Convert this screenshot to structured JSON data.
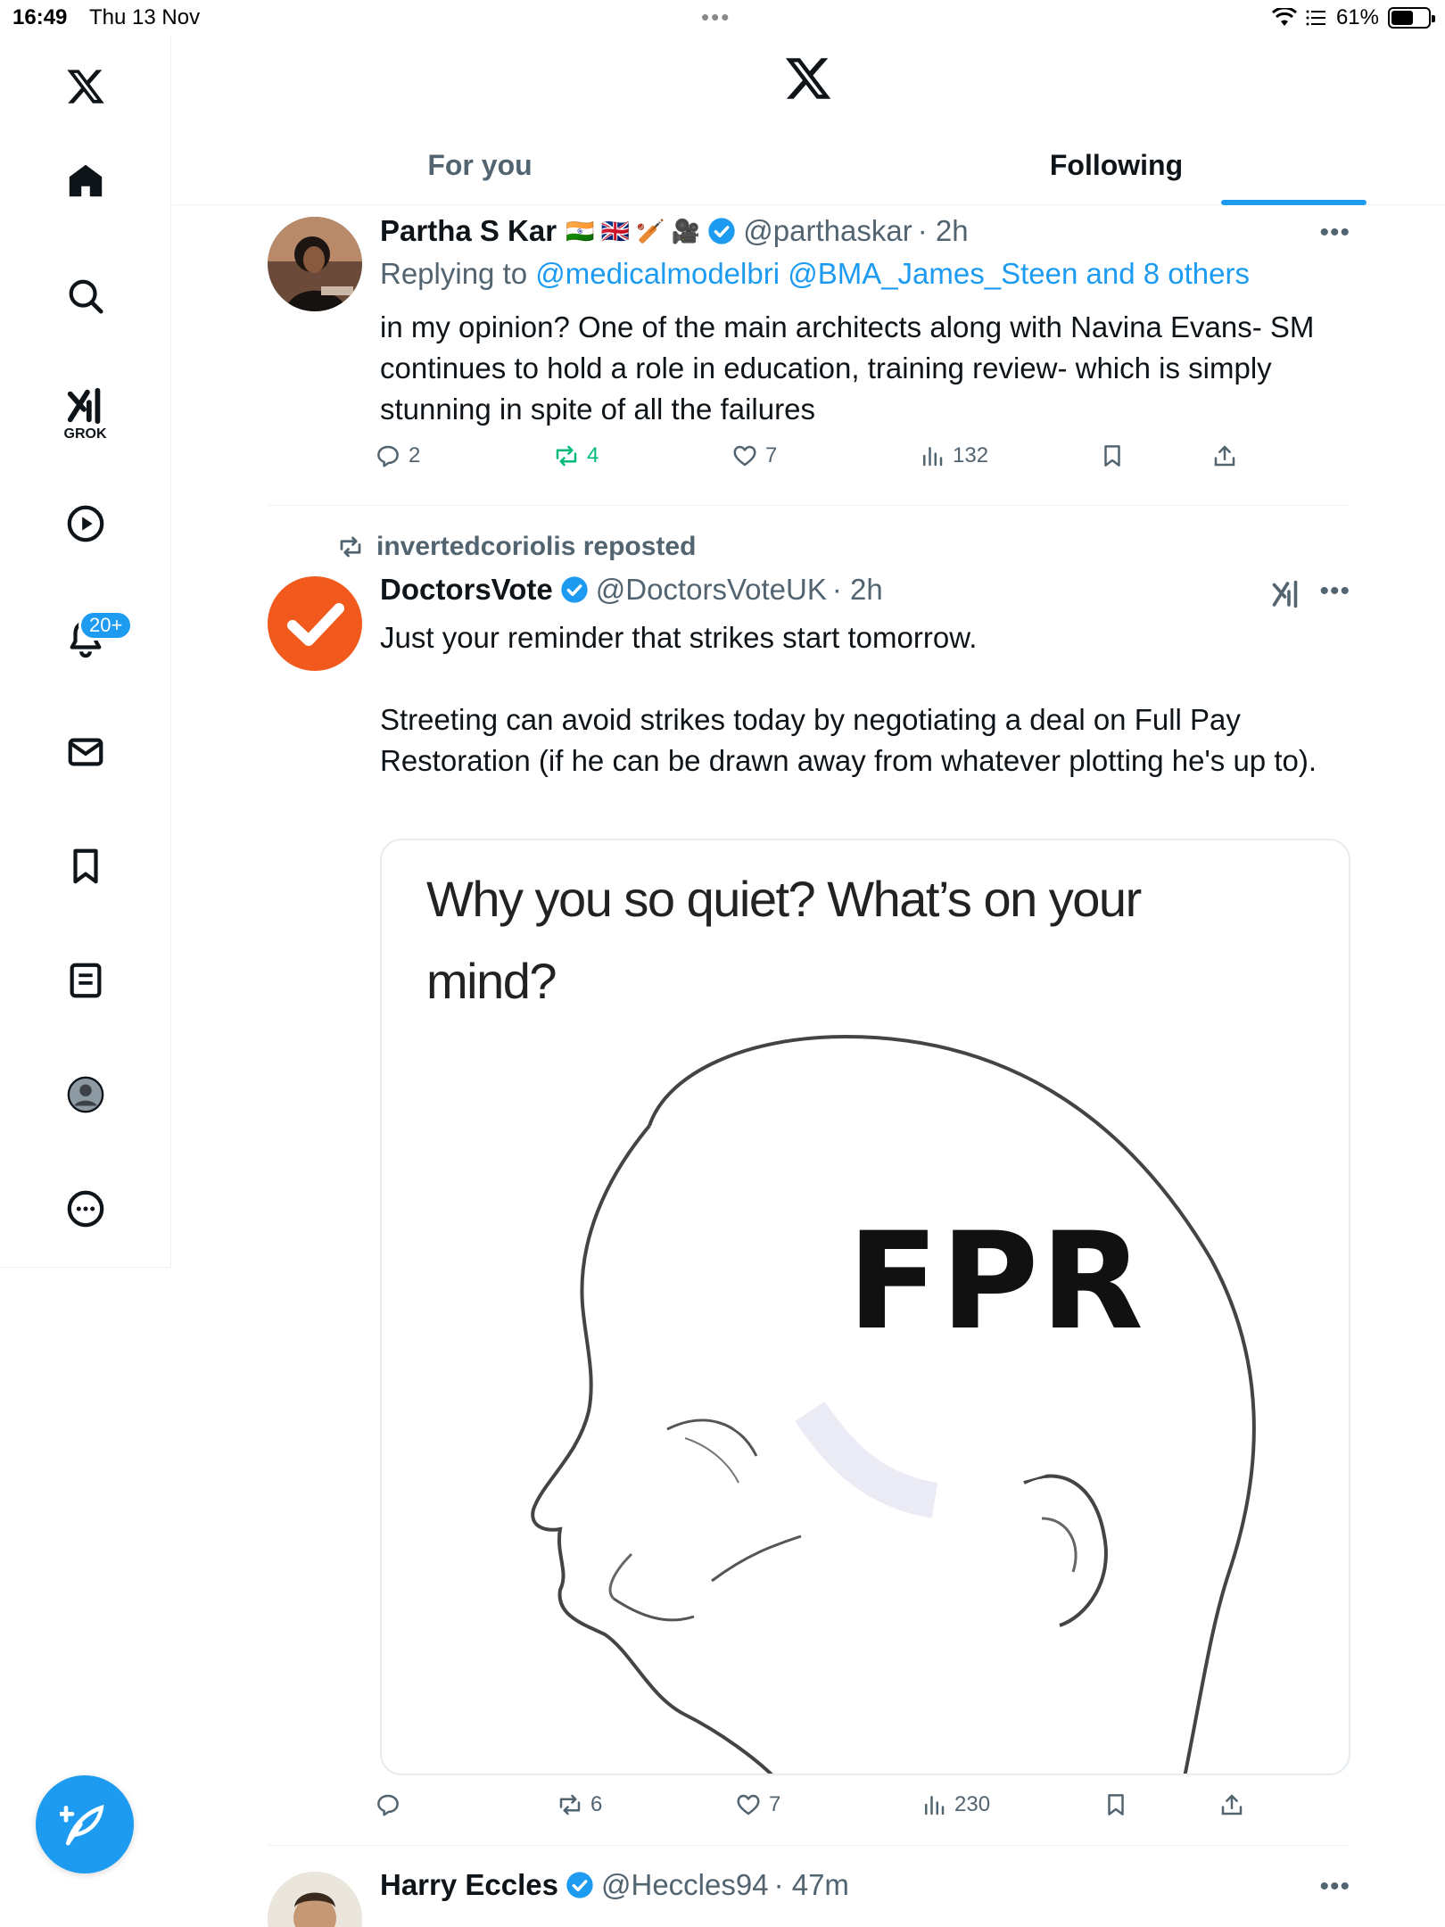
{
  "status_bar": {
    "time": "16:49",
    "date": "Thu 13 Nov",
    "battery_text": "61%",
    "battery_level": 0.61
  },
  "sidebar": {
    "items": [
      {
        "name": "x-logo-icon"
      },
      {
        "name": "home-icon"
      },
      {
        "name": "search-icon"
      },
      {
        "name": "grok-icon",
        "label": "GROK"
      },
      {
        "name": "video-icon"
      },
      {
        "name": "notifications-icon",
        "badge": "20+"
      },
      {
        "name": "messages-icon"
      },
      {
        "name": "bookmarks-icon"
      },
      {
        "name": "lists-icon"
      },
      {
        "name": "profile-icon"
      },
      {
        "name": "more-icon"
      }
    ],
    "compose_icon": "compose-icon"
  },
  "header": {
    "logo": "x-logo-icon",
    "tabs": [
      {
        "label": "For you",
        "active": false
      },
      {
        "label": "Following",
        "active": true
      }
    ]
  },
  "tweets": [
    {
      "name": "Partha S Kar",
      "flags": "🇮🇳 🇬🇧 🏏 🎥",
      "verified": true,
      "handle": "@parthaskar",
      "time": "· 2h",
      "replying_prefix": "Replying to ",
      "replying_to": "@medicalmodelbri @BMA_James_Steen and 8 others",
      "text": "in my opinion? One of the main architects along with Navina Evans- SM continues to hold a role in education, training review- which is simply stunning in spite of all the failures",
      "replies": "2",
      "reposts": "4",
      "likes": "7",
      "views": "132"
    },
    {
      "reposted_by": "invertedcoriolis reposted",
      "name": "DoctorsVote",
      "verified": true,
      "handle": "@DoctorsVoteUK",
      "time": "· 2h",
      "text": "Just your reminder that strikes start tomorrow.\n\nStreeting can avoid strikes today by negotiating a deal on Full Pay Restoration (if he can be drawn away from whatever plotting he's up to).",
      "media": {
        "caption": "Why you so quiet? What’s on your mind?",
        "brain_text": "FPR"
      },
      "replies": "",
      "reposts": "6",
      "likes": "7",
      "views": "230"
    },
    {
      "name": "Harry Eccles",
      "verified": true,
      "handle": "@Heccles94",
      "time": "· 47m"
    }
  ],
  "colors": {
    "accent": "#1d9bf0",
    "secondary_text": "#536471",
    "repost_active": "#00ba7c",
    "doctorsvote_brand": "#f25a1d"
  }
}
